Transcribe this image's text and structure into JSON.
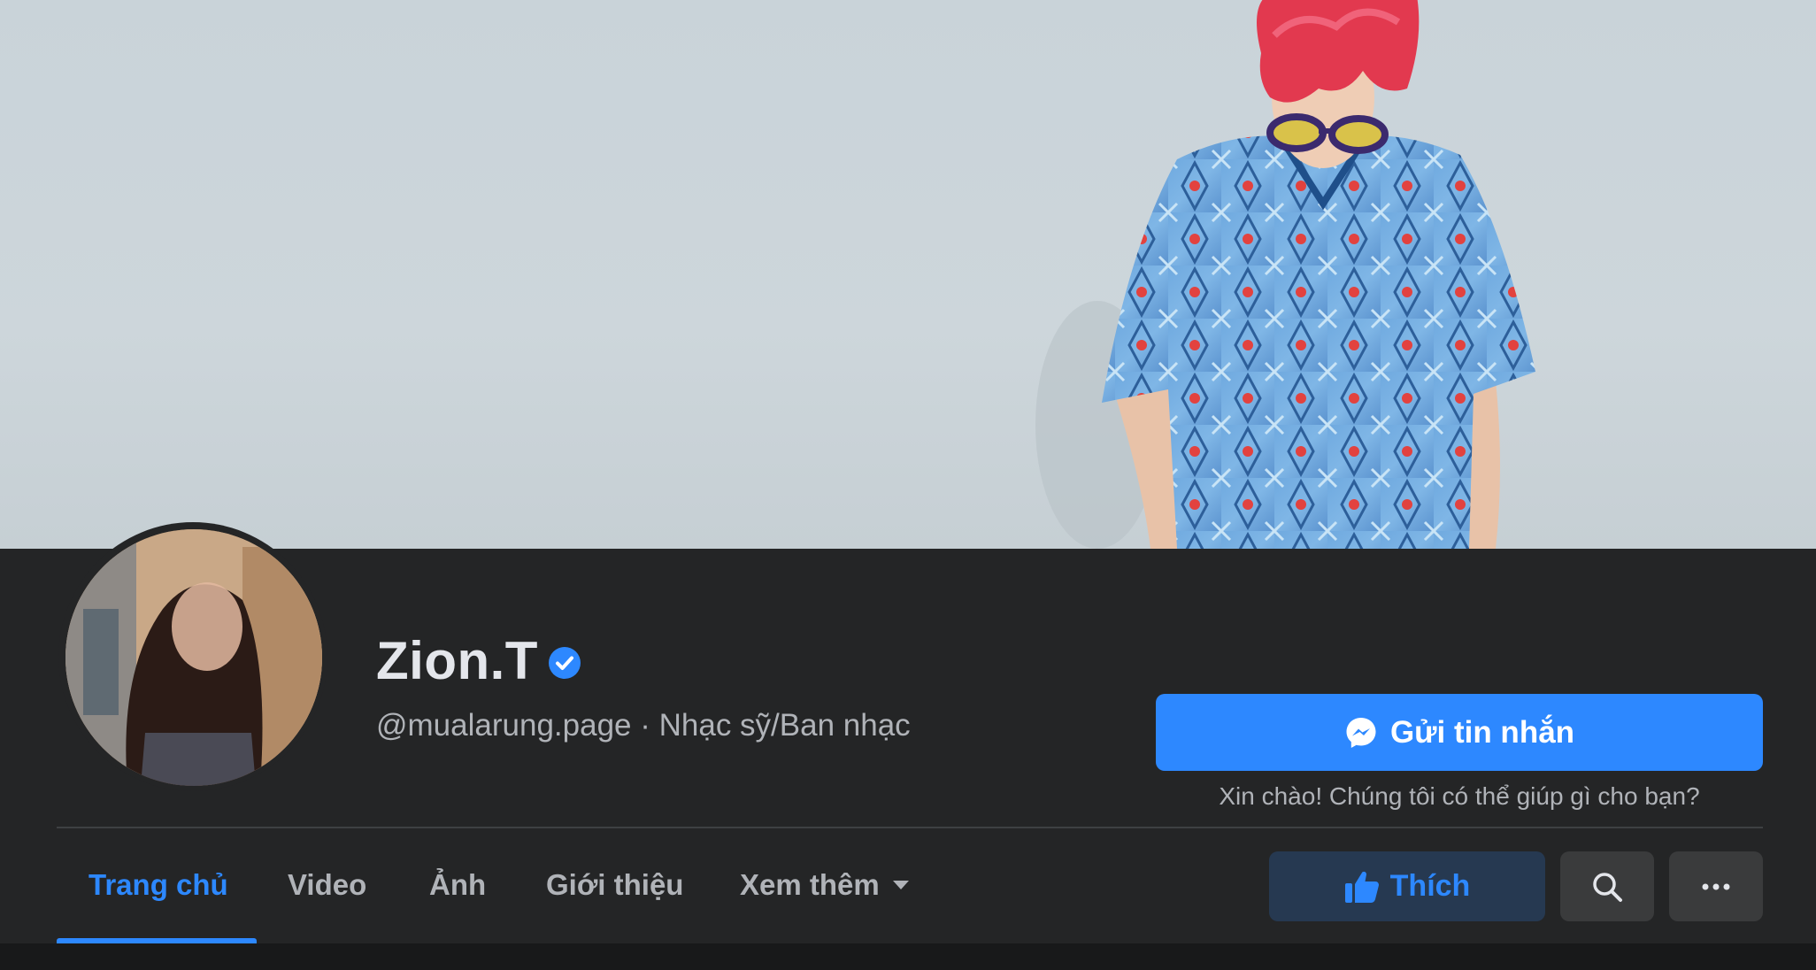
{
  "page": {
    "name": "Zion.T",
    "verified": true,
    "handle": "@mualarung.page",
    "separator": " · ",
    "category": "Nhạc sỹ/Ban nhạc"
  },
  "actions": {
    "message_label": "Gửi tin nhắn",
    "greeting": "Xin chào! Chúng tôi có thể giúp gì cho bạn?",
    "like_label": "Thích"
  },
  "tabs": [
    {
      "label": "Trang chủ",
      "active": true
    },
    {
      "label": "Video",
      "active": false
    },
    {
      "label": "Ảnh",
      "active": false
    },
    {
      "label": "Giới thiệu",
      "active": false
    },
    {
      "label": "Xem thêm",
      "active": false
    }
  ],
  "colors": {
    "accent": "#2d88ff",
    "panel": "#242526",
    "like_bg": "#263951"
  },
  "icons": {
    "verified": "verified-badge-icon",
    "messenger": "messenger-icon",
    "thumbs_up": "thumbs-up-icon",
    "dropdown": "caret-down-icon",
    "search": "search-icon",
    "more": "more-horizontal-icon"
  }
}
